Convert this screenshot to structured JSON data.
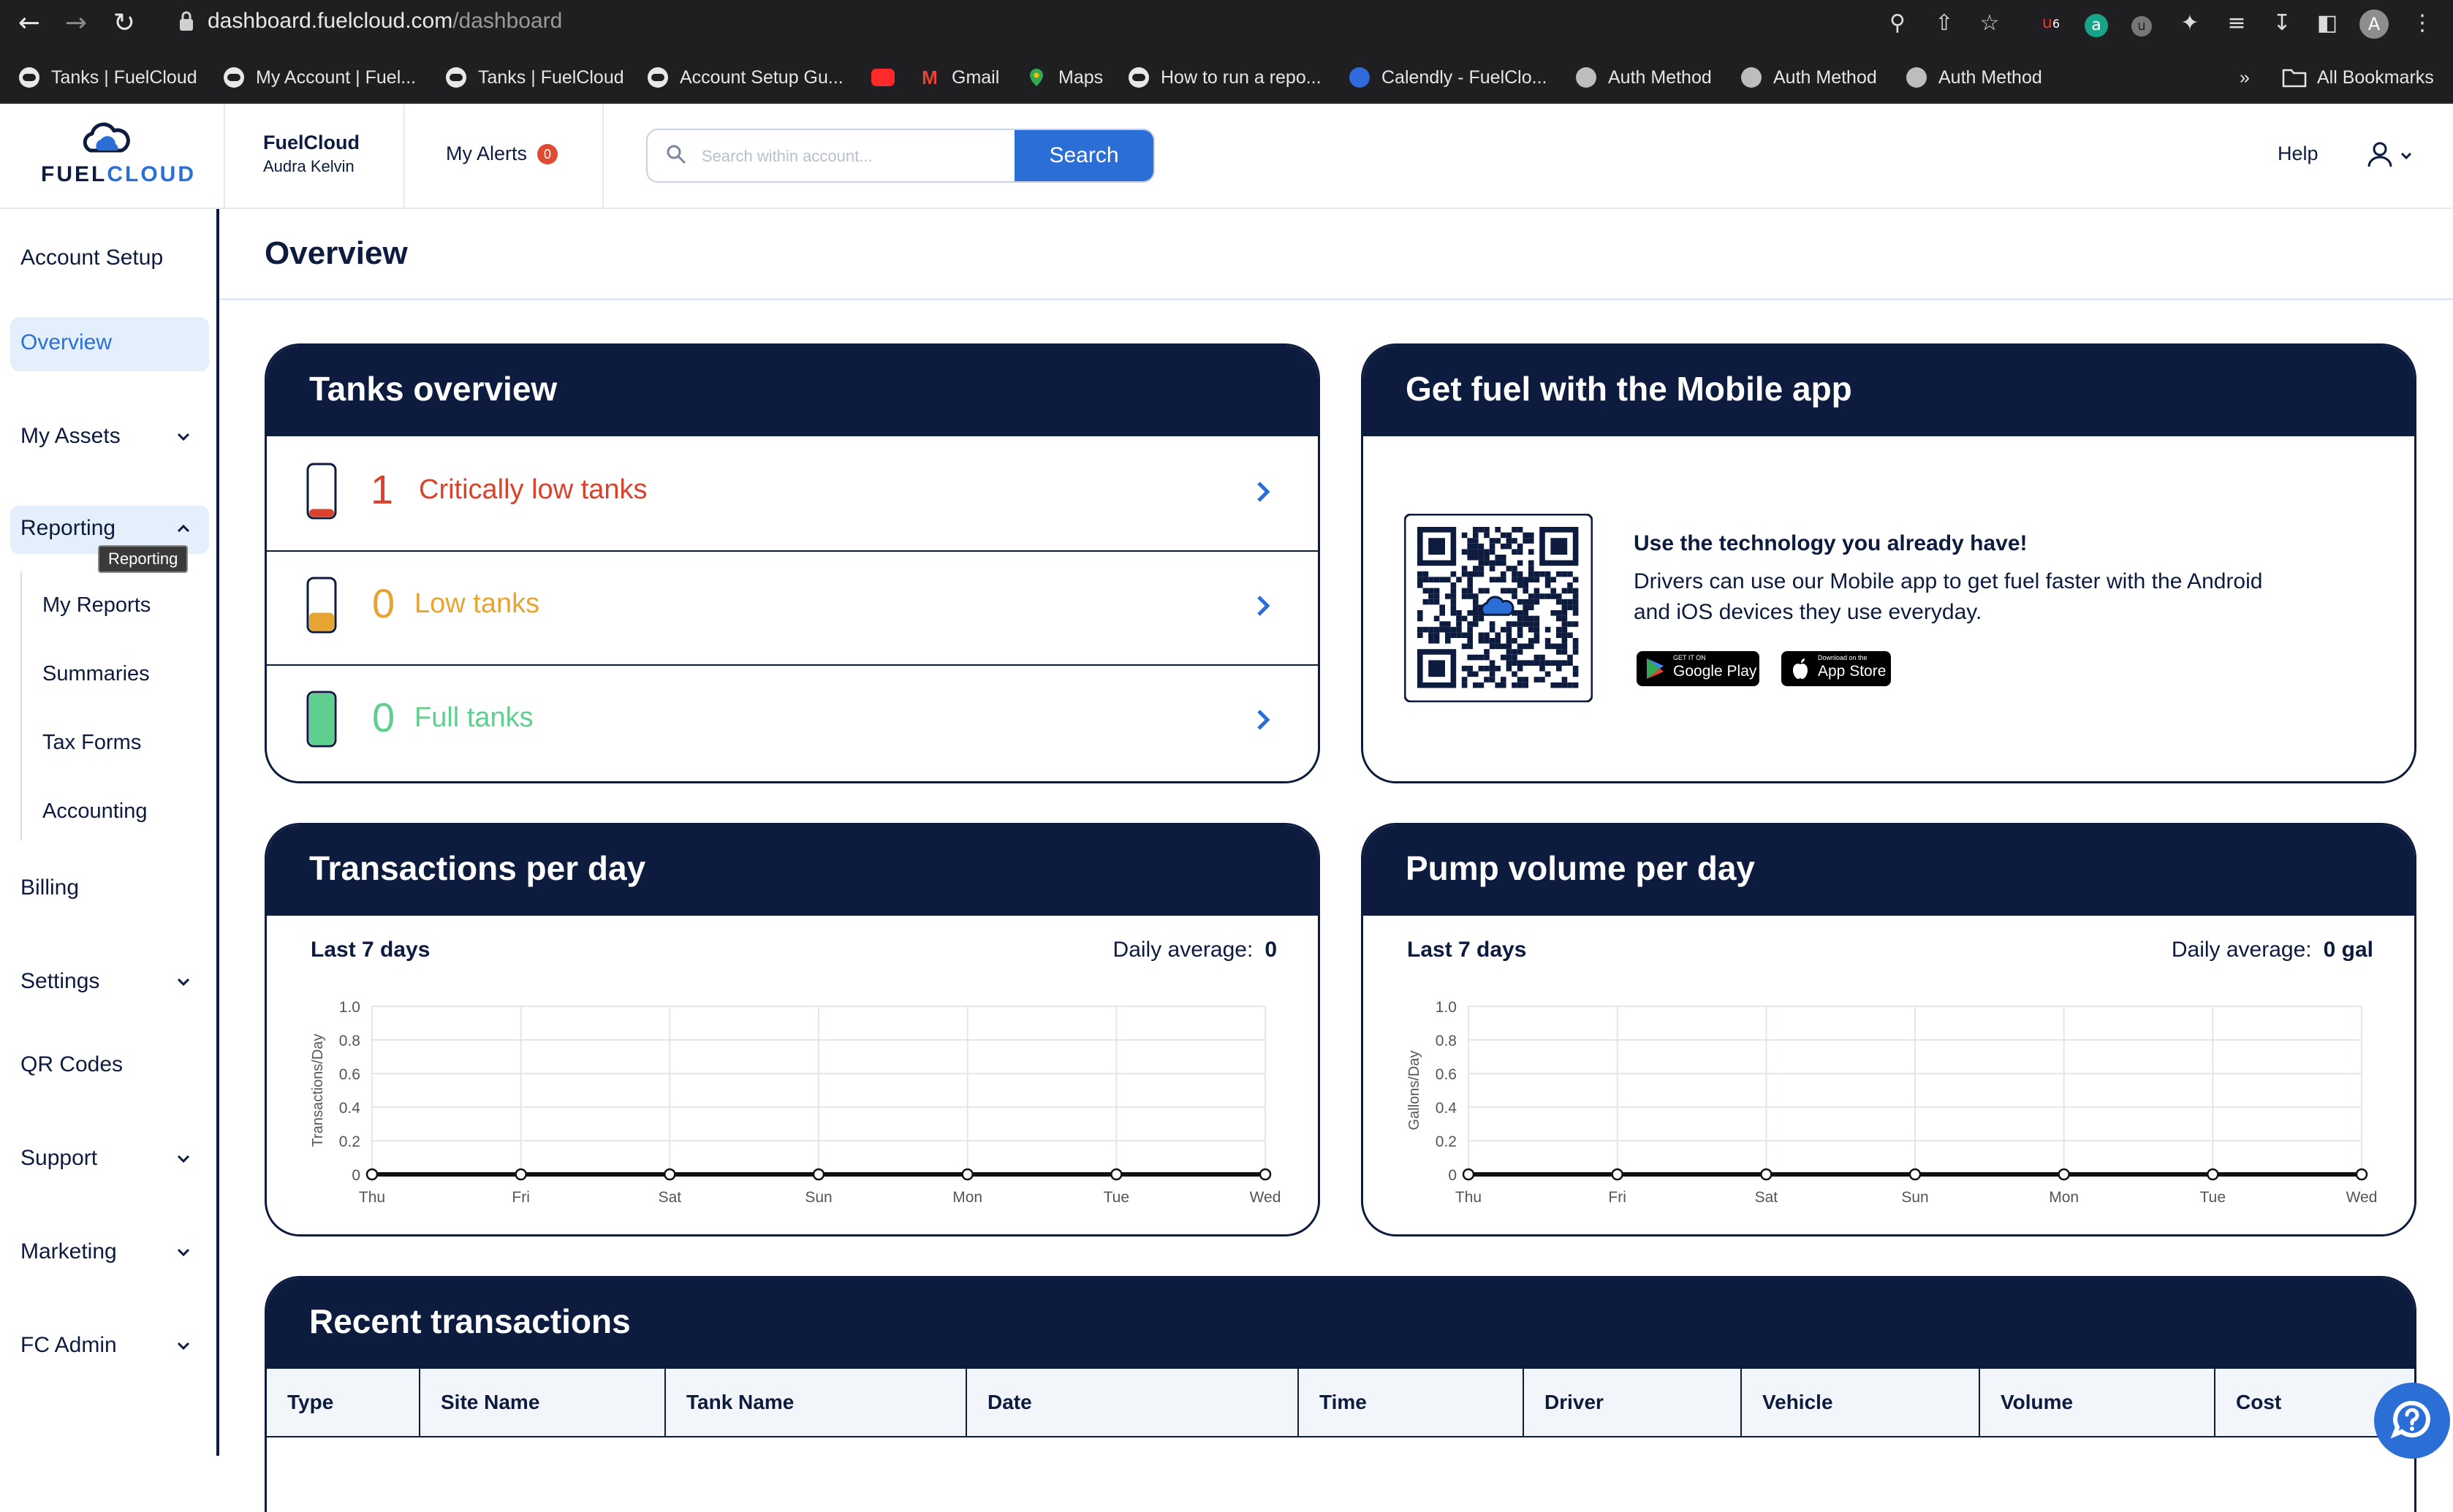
{
  "browser": {
    "url_host": "dashboard.fuelcloud.com",
    "url_path": "/dashboard",
    "bookmarks": [
      {
        "label": "Tanks | FuelCloud",
        "icon": "fuelcloud-favicon"
      },
      {
        "label": "My Account | Fuel...",
        "icon": "fuelcloud-favicon"
      },
      {
        "label": "Tanks | FuelCloud",
        "icon": "fuelcloud-favicon"
      },
      {
        "label": "Account Setup Gu...",
        "icon": "fuelcloud-favicon"
      },
      {
        "label": "",
        "icon": "youtube-icon"
      },
      {
        "label": "Gmail",
        "icon": "gmail-icon"
      },
      {
        "label": "Maps",
        "icon": "maps-icon"
      },
      {
        "label": "How to run a repo...",
        "icon": "fuelcloud-favicon"
      },
      {
        "label": "Calendly - FuelClo...",
        "icon": "calendly-icon"
      },
      {
        "label": "Auth Method",
        "icon": "globe-icon"
      },
      {
        "label": "Auth Method",
        "icon": "globe-icon"
      },
      {
        "label": "Auth Method",
        "icon": "globe-icon"
      }
    ],
    "overflow": "»",
    "all_bookmarks": "All Bookmarks",
    "ext_badge": "6",
    "avatar_letter": "A"
  },
  "header": {
    "logo_word_1": "FUEL",
    "logo_word_2": "CLOUD",
    "company": "FuelCloud",
    "user": "Audra Kelvin",
    "alerts_label": "My Alerts",
    "alerts_count": "0",
    "search_placeholder": "Search within account...",
    "search_button": "Search",
    "help": "Help"
  },
  "sidebar": {
    "items": {
      "account_setup": "Account Setup",
      "overview": "Overview",
      "my_assets": "My Assets",
      "reporting": "Reporting",
      "my_reports": "My Reports",
      "summaries": "Summaries",
      "tax_forms": "Tax Forms",
      "accounting": "Accounting",
      "billing": "Billing",
      "settings": "Settings",
      "qr_codes": "QR Codes",
      "support": "Support",
      "marketing": "Marketing",
      "fc_admin": "FC Admin"
    },
    "tooltip": "Reporting"
  },
  "main": {
    "title": "Overview",
    "tanks": {
      "title": "Tanks overview",
      "rows": [
        {
          "count": "1",
          "label": "Critically low tanks",
          "color": "#d9432c",
          "fill": 0.15
        },
        {
          "count": "0",
          "label": "Low tanks",
          "color": "#e8a431",
          "fill": 0.35
        },
        {
          "count": "0",
          "label": "Full tanks",
          "color": "#5fcf8f",
          "fill": 1.0
        }
      ]
    },
    "mobile": {
      "title": "Get fuel with the Mobile app",
      "heading": "Use the technology you already have!",
      "body": "Drivers can use our Mobile app to get fuel faster with the Android and iOS devices they use everyday.",
      "google_small": "GET IT ON",
      "google_big": "Google Play",
      "apple_small": "Download on the",
      "apple_big": "App Store"
    },
    "transactions": {
      "title": "Transactions per day",
      "range": "Last 7 days",
      "avg_label": "Daily average:",
      "avg_value": "0"
    },
    "pump": {
      "title": "Pump volume per day",
      "range": "Last 7 days",
      "avg_label": "Daily average:",
      "avg_value": "0 gal"
    },
    "recent": {
      "title": "Recent transactions",
      "columns": [
        "Type",
        "Site Name",
        "Tank Name",
        "Date",
        "Time",
        "Driver",
        "Vehicle",
        "Volume",
        "Cost"
      ]
    }
  },
  "chart_data": [
    {
      "type": "line",
      "ylabel": "Transactions/Day",
      "categories": [
        "Thu",
        "Fri",
        "Sat",
        "Sun",
        "Mon",
        "Tue",
        "Wed"
      ],
      "series": [
        {
          "values": [
            0,
            0,
            0,
            0,
            0,
            0,
            0
          ]
        }
      ],
      "yticks": [
        "0",
        "0.2",
        "0.4",
        "0.6",
        "0.8",
        "1.0"
      ],
      "ylim": [
        0,
        1.0
      ],
      "grid": true
    },
    {
      "type": "line",
      "ylabel": "Gallons/Day",
      "categories": [
        "Thu",
        "Fri",
        "Sat",
        "Sun",
        "Mon",
        "Tue",
        "Wed"
      ],
      "series": [
        {
          "values": [
            0,
            0,
            0,
            0,
            0,
            0,
            0
          ]
        }
      ],
      "yticks": [
        "0",
        "0.2",
        "0.4",
        "0.6",
        "0.8",
        "1.0"
      ],
      "ylim": [
        0,
        1.0
      ],
      "grid": true
    }
  ]
}
